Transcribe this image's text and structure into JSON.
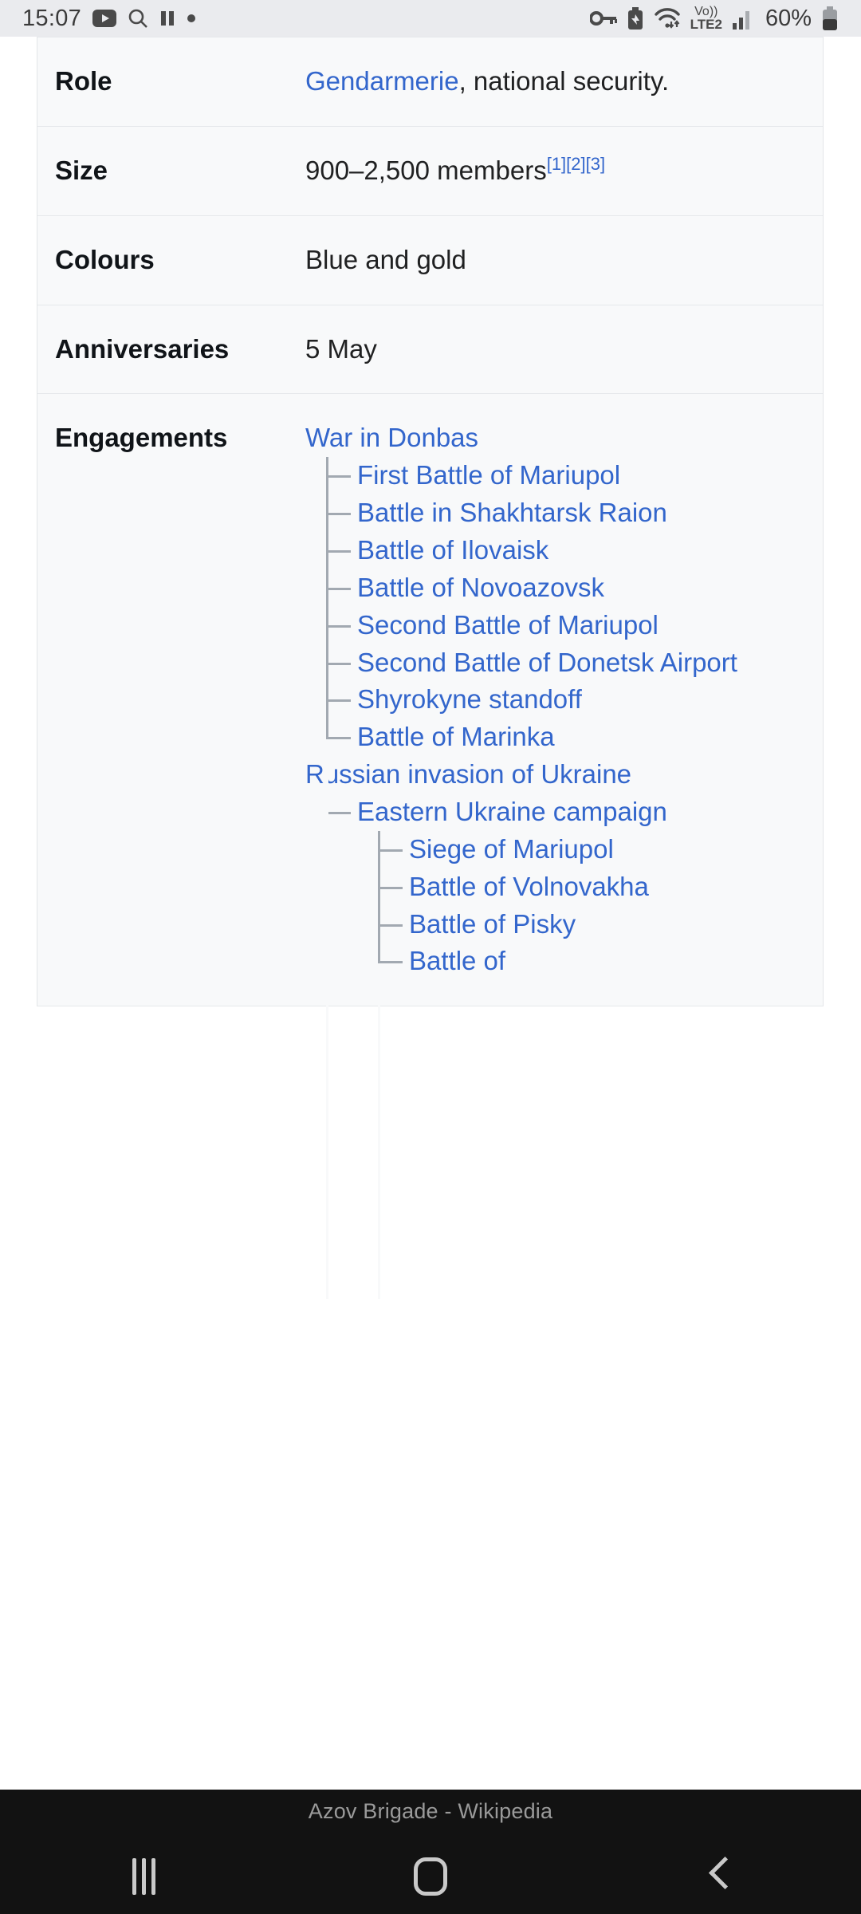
{
  "status_bar": {
    "clock": "15:07",
    "battery_percent": "60%",
    "network_label": "LTE2",
    "voice_label": "Vo))",
    "icons": [
      "youtube-icon",
      "search-icon",
      "pause-icon",
      "dot-icon",
      "vpn-key-icon",
      "battery-saver-icon",
      "wifi-icon",
      "volte-icon",
      "signal-bars-icon",
      "battery-icon"
    ]
  },
  "infobox": {
    "rows": [
      {
        "label": "Role",
        "value_parts": [
          {
            "type": "link",
            "text": "Gendarmerie"
          },
          {
            "type": "text",
            "text": ", national security."
          }
        ]
      },
      {
        "label": "Size",
        "value_parts": [
          {
            "type": "text",
            "text": "900–2,500 members"
          },
          {
            "type": "refs",
            "text": "[1][2][3]"
          }
        ]
      },
      {
        "label": "Colours",
        "value_parts": [
          {
            "type": "text",
            "text": "Blue and gold"
          }
        ]
      },
      {
        "label": "Anniversaries",
        "value_parts": [
          {
            "type": "text",
            "text": "5 May"
          }
        ]
      },
      {
        "label": "Engagements",
        "value_parts": []
      }
    ],
    "engagements": {
      "campaigns": [
        {
          "name": "War in Donbas",
          "battles": [
            "First Battle of Mariupol",
            "Battle in Shakhtarsk Raion",
            "Battle of Ilovaisk",
            "Battle of Novoazovsk",
            "Second Battle of Mariupol",
            "Second Battle of Donetsk Airport",
            "Shyrokyne standoff",
            "Battle of Marinka"
          ]
        },
        {
          "name": "Russian invasion of Ukraine",
          "subcampaigns": [
            {
              "name": "Eastern Ukraine campaign",
              "battles": [
                "Siege of Mariupol",
                "Battle of Volnovakha",
                "Battle of Pisky",
                "Battle of"
              ]
            }
          ]
        }
      ]
    }
  },
  "bottom": {
    "tab_title": "Azov Brigade - Wikipedia",
    "nav": {
      "recents_label": "Recents",
      "home_label": "Home",
      "back_label": "Back"
    }
  },
  "colors": {
    "link": "#3366cc",
    "infobox_bg": "#f8f9fa",
    "tree_line": "#a2a9b1",
    "status_bar_bg": "#eaebee",
    "nav_bar_bg": "#121212"
  }
}
